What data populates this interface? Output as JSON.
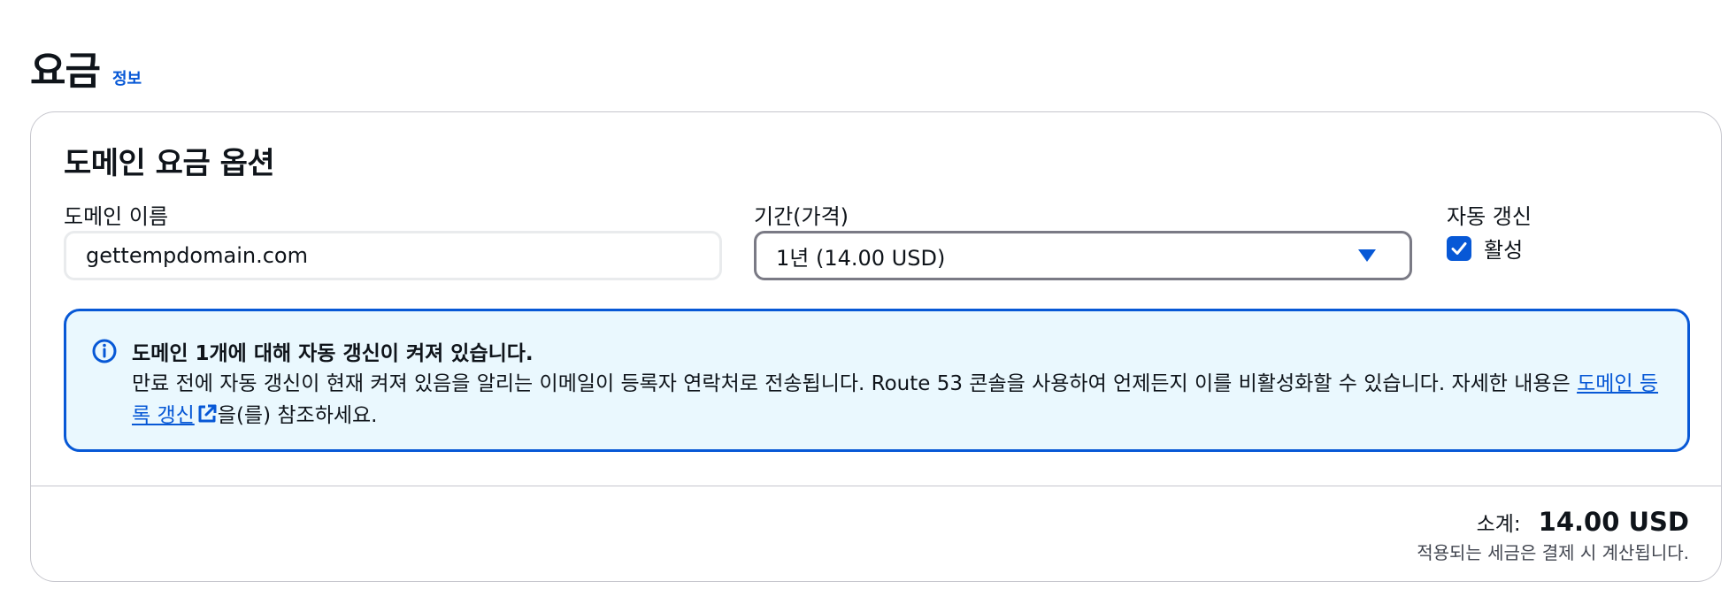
{
  "header": {
    "title": "요금",
    "info_link": "정보"
  },
  "panel": {
    "title": "도메인 요금 옵션",
    "domain_name": {
      "label": "도메인 이름",
      "value": "gettempdomain.com"
    },
    "duration": {
      "label": "기간(가격)",
      "selected": "1년 (14.00 USD)"
    },
    "auto_renew": {
      "label": "자동 갱신",
      "checkbox_label": "활성",
      "checked": true
    },
    "alert": {
      "title": "도메인 1개에 대해 자동 갱신이 켜져 있습니다.",
      "body_text": "만료 전에 자동 갱신이 현재 켜져 있음을 알리는 이메일이 등록자 연락처로 전송됩니다. Route 53 콘솔을 사용하여 언제든지 이를 비활성화할 수 있습니다. 자세한 내용은 ",
      "link_text": "도메인 등록 갱신",
      "body_suffix": "을(를) 참조하세요.",
      "icon": "info-circle-icon"
    },
    "summary": {
      "subtotal_label": "소계:",
      "subtotal_value": "14.00 USD",
      "tax_note": "적용되는 세금은 결제 시 계산됩니다."
    }
  },
  "colors": {
    "accent": "#0758d6",
    "alert_background": "#eaf8fe",
    "text": "#0f141a",
    "border": "#c6c6cd"
  }
}
